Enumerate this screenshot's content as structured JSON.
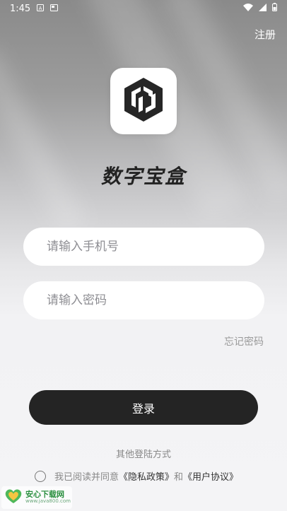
{
  "status_bar": {
    "time": "1:45",
    "icons": [
      "notification-a-icon",
      "screen-icon",
      "wifi-icon",
      "cellular-signal-icon",
      "battery-icon"
    ]
  },
  "header": {
    "register_label": "注册"
  },
  "app": {
    "title": "数字宝盒",
    "logo_icon": "cube-logo-icon"
  },
  "form": {
    "phone_placeholder": "请输入手机号",
    "password_placeholder": "请输入密码",
    "forgot_password_label": "忘记密码",
    "login_label": "登录"
  },
  "footer": {
    "other_login_label": "其他登陆方式",
    "agreement_prefix": "我已阅读并同意",
    "privacy_link": "《隐私政策》",
    "conjunction": "和",
    "user_agreement_link": "《用户协议》"
  },
  "watermark": {
    "brand": "安心下载网",
    "url": "www.java800.com"
  },
  "colors": {
    "button_bg": "#242424",
    "field_bg": "#ffffff",
    "placeholder": "#8e8e93",
    "watermark_green": "#2a8f3f"
  }
}
